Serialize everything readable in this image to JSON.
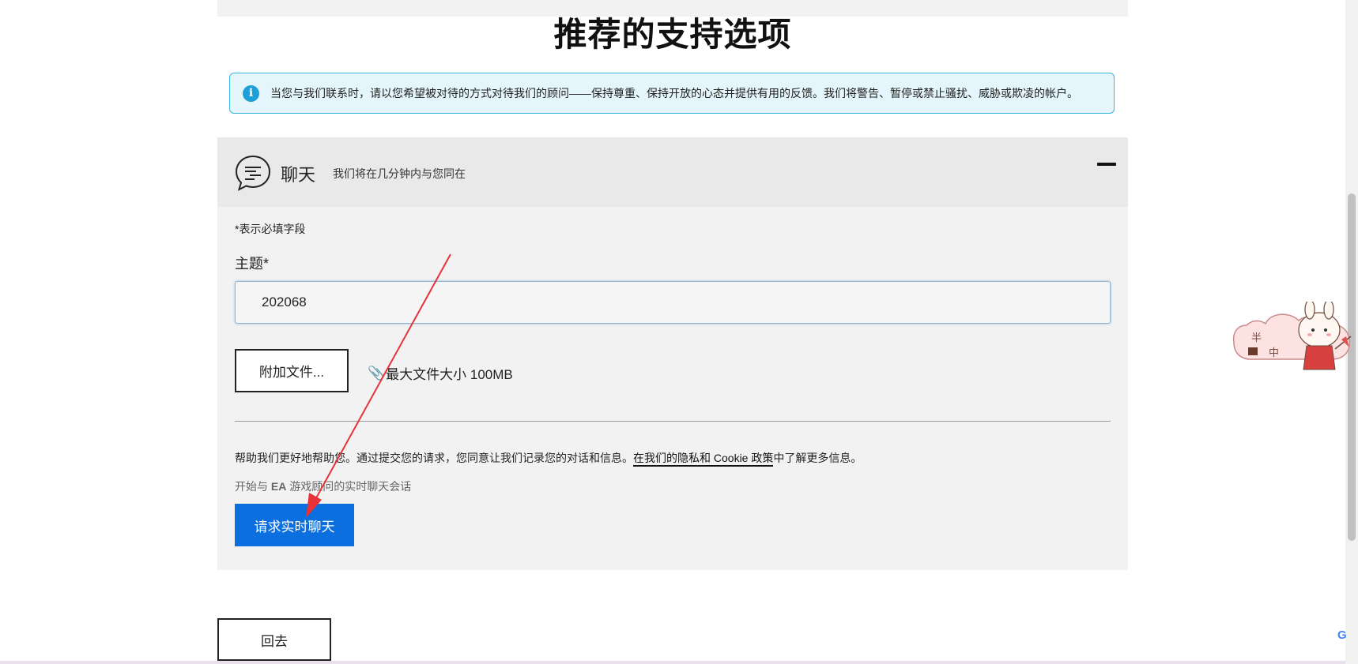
{
  "page": {
    "title": "推荐的支持选项"
  },
  "notice": {
    "icon": "info-icon",
    "text": "当您与我们联系时，请以您希望被对待的方式对待我们的顾问——保持尊重、保持开放的心态并提供有用的反馈。我们将警告、暂停或禁止骚扰、威胁或欺凌的帐户。"
  },
  "chat": {
    "icon": "chat-bubble-icon",
    "title": "聊天",
    "subtitle": "我们将在几分钟内与您同在",
    "collapse_icon": "minus-icon",
    "required_note": "*表示必填字段",
    "subject_label": "主题*",
    "subject_value": "202068",
    "attach_label": "附加文件...",
    "file_limit": "最大文件大小 100MB",
    "help_text_before": "帮助我们更好地帮助您。通过提交您的请求，您同意让我们记录您的对话和信息。",
    "privacy_link": "在我们的隐私和 Cookie 政策",
    "help_text_after": "中了解更多信息。",
    "start_prefix": "开始与 ",
    "start_brand": "EA",
    "start_suffix": " 游戏顾问的实时聊天会话",
    "request_button": "请求实时聊天"
  },
  "back_button": "回去",
  "mascot": {
    "text_top": "半",
    "text_bottom": "中"
  },
  "g_badge": "G",
  "colors": {
    "notice_bg": "#e4f5fb",
    "notice_border": "#3ab4e0",
    "primary_button": "#0b6fe0",
    "panel_bg": "#f2f2f2",
    "annotation_arrow": "#e8323a"
  }
}
